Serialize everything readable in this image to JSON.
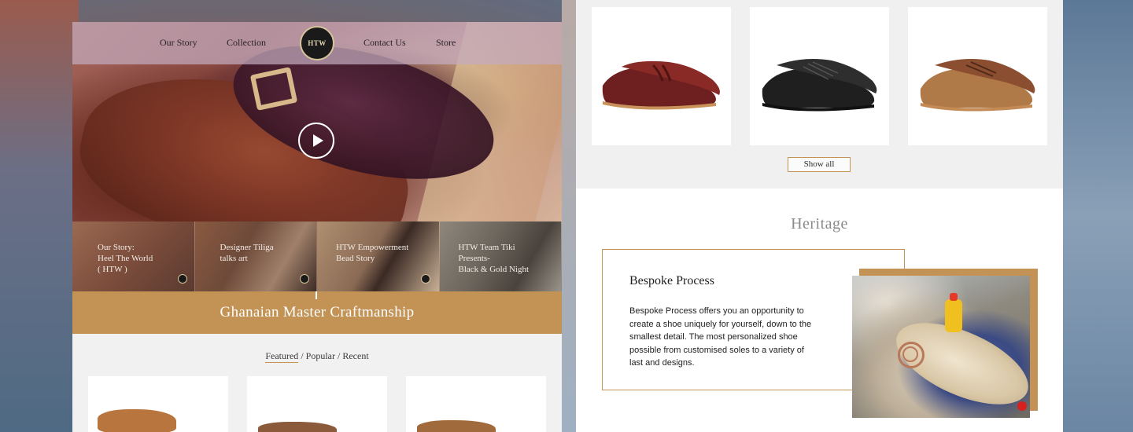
{
  "nav": {
    "items": [
      "Our Story",
      "Collection",
      "Contact Us",
      "Store"
    ],
    "logo_text": "HTW"
  },
  "hero": {
    "play_icon": "play-icon"
  },
  "thumbs": [
    {
      "text": "Our Story:\nHeel The World\n( HTW )"
    },
    {
      "text": "Designer Tiliga\ntalks art"
    },
    {
      "text": "HTW Empowerment\nBead Story"
    },
    {
      "text": "HTW Team Tiki\nPresents-\nBlack & Gold Night"
    }
  ],
  "banner": {
    "title": "Ghanaian Master Craftmanship"
  },
  "filters": {
    "featured": "Featured",
    "popular": "Popular",
    "recent": "Recent",
    "separator": "/"
  },
  "products": {
    "show_all": "Show all"
  },
  "heritage": {
    "title": "Heritage",
    "bespoke_title": "Bespoke Process",
    "bespoke_body": "Bespoke Process offers you an opportunity to create a shoe uniquely for yourself, down to the smallest detail. The most personalized shoe possible from customised soles to a variety of last and designs."
  },
  "colors": {
    "accent": "#c39356",
    "background": "#f1f1f1"
  }
}
